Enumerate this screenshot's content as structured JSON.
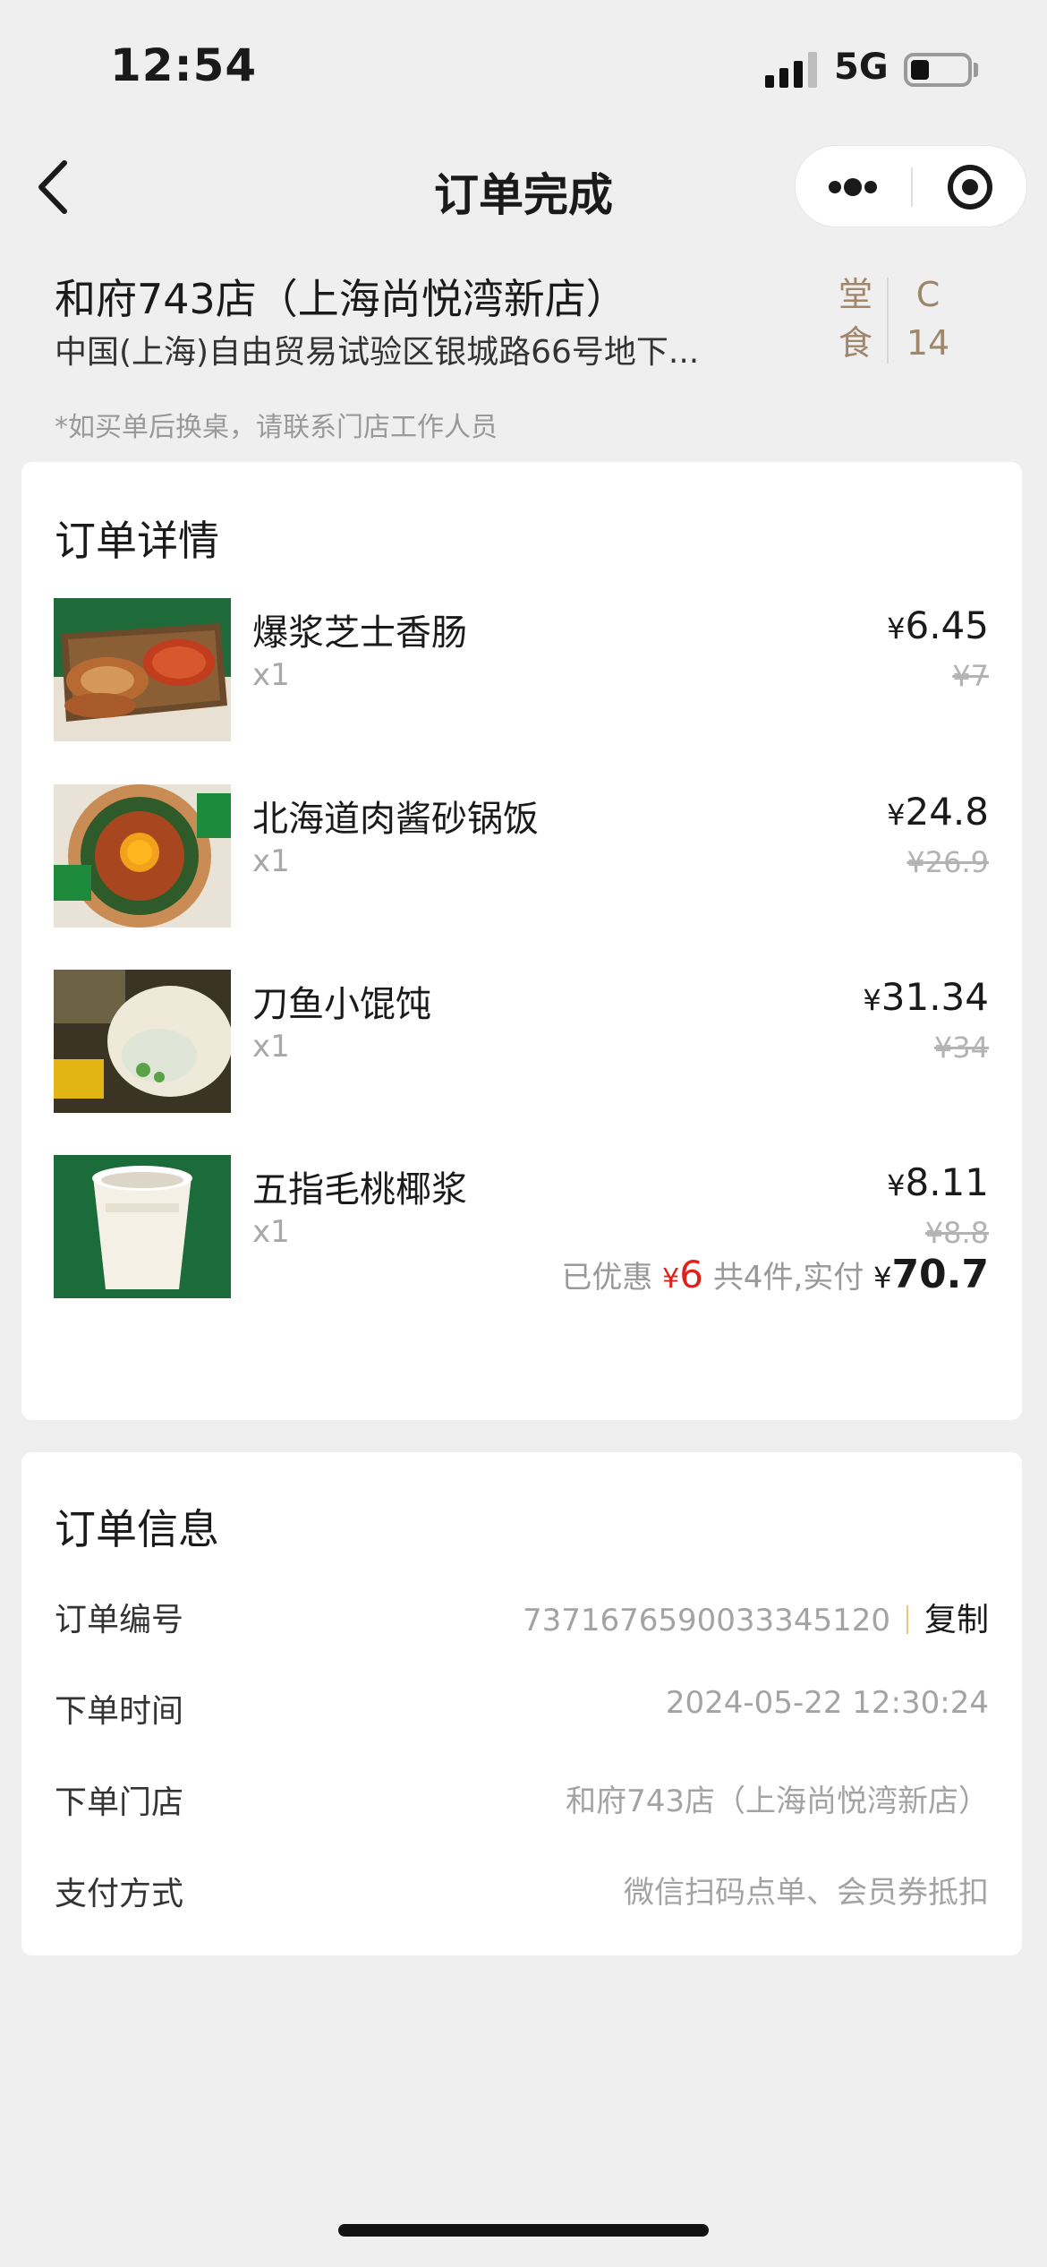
{
  "status_bar": {
    "time": "12:54",
    "network": "5G"
  },
  "nav": {
    "title": "订单完成"
  },
  "store": {
    "name": "和府743店（上海尚悦湾新店）",
    "address": "中国(上海)自由贸易试验区银城路66号地下...",
    "dine_type": [
      "堂",
      "食"
    ],
    "table_no": [
      "C",
      "14"
    ],
    "note": "*如买单后换桌，请联系门店工作人员"
  },
  "order_detail": {
    "title": "订单详情",
    "items": [
      {
        "name": "爆浆芝士香肠",
        "qty": "x1",
        "currency": "¥",
        "price": "6.45",
        "original_price": "¥7"
      },
      {
        "name": "北海道肉酱砂锅饭",
        "qty": "x1",
        "currency": "¥",
        "price": "24.8",
        "original_price": "¥26.9"
      },
      {
        "name": "刀鱼小馄饨",
        "qty": "x1",
        "currency": "¥",
        "price": "31.34",
        "original_price": "¥34"
      },
      {
        "name": "五指毛桃椰浆",
        "qty": "x1",
        "currency": "¥",
        "price": "8.11",
        "original_price": "¥8.8"
      }
    ],
    "summary": {
      "discount_label": "已优惠",
      "currency": "¥",
      "discount": "6",
      "count_label": "共4件,实付",
      "total": "70.7"
    }
  },
  "order_info": {
    "title": "订单信息",
    "rows": [
      {
        "label": "订单编号",
        "value": "7371676590033345120",
        "action": "复制"
      },
      {
        "label": "下单时间",
        "value": "2024-05-22 12:30:24"
      },
      {
        "label": "下单门店",
        "value": "和府743店（上海尚悦湾新店）"
      },
      {
        "label": "支付方式",
        "value": "微信扫码点单、会员券抵扣"
      }
    ]
  },
  "icons": {
    "back": "chevron-left-icon",
    "more": "more-dots-icon",
    "close": "close-circle-icon"
  },
  "colors": {
    "accent": "#a0866a",
    "discount": "#e0201b",
    "background": "#efefef"
  }
}
